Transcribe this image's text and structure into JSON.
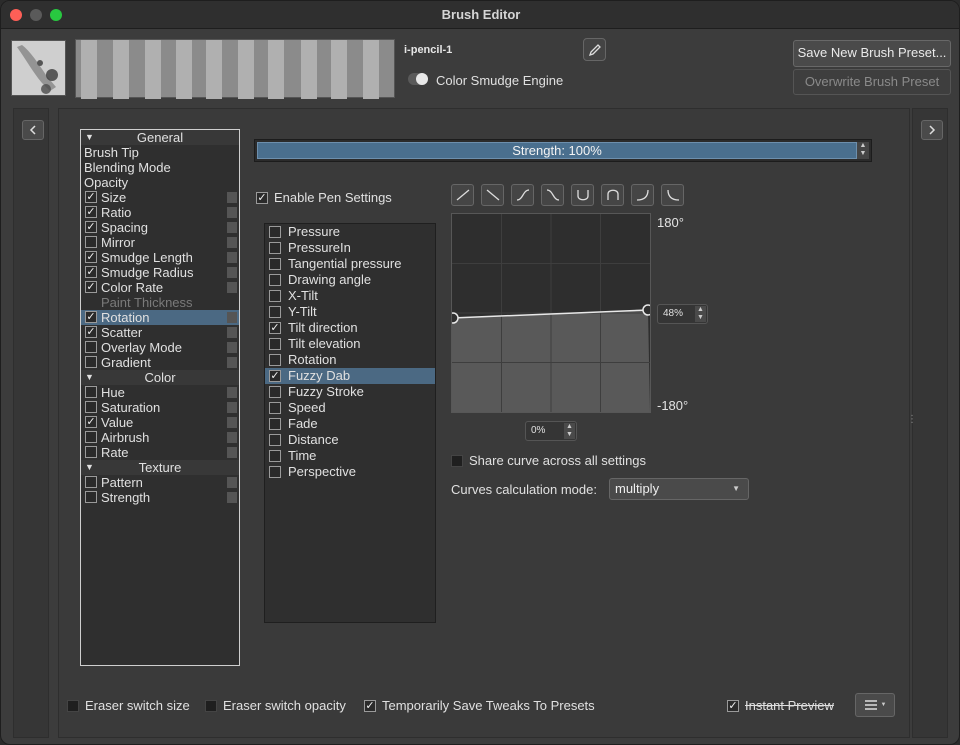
{
  "window": {
    "title": "Brush Editor"
  },
  "header": {
    "preset_name": "i-pencil-1",
    "engine_label": "Color Smudge Engine",
    "save_new_label": "Save New Brush Preset...",
    "overwrite_label": "Overwrite Brush Preset"
  },
  "options": {
    "items": [
      {
        "label": "General",
        "type": "header"
      },
      {
        "label": "Brush Tip",
        "type": "plain"
      },
      {
        "label": "Blending Mode",
        "type": "plain"
      },
      {
        "label": "Opacity",
        "type": "plain"
      },
      {
        "label": "Size",
        "type": "check",
        "checked": true
      },
      {
        "label": "Ratio",
        "type": "check",
        "checked": true
      },
      {
        "label": "Spacing",
        "type": "check",
        "checked": true
      },
      {
        "label": "Mirror",
        "type": "check",
        "checked": false
      },
      {
        "label": "Smudge Length",
        "type": "check",
        "checked": true
      },
      {
        "label": "Smudge Radius",
        "type": "check",
        "checked": true
      },
      {
        "label": "Color Rate",
        "type": "check",
        "checked": true
      },
      {
        "label": "Paint Thickness",
        "type": "disabled"
      },
      {
        "label": "Rotation",
        "type": "check",
        "checked": true,
        "selected": true
      },
      {
        "label": "Scatter",
        "type": "check",
        "checked": true
      },
      {
        "label": "Overlay Mode",
        "type": "check",
        "checked": false
      },
      {
        "label": "Gradient",
        "type": "check",
        "checked": false
      },
      {
        "label": "Color",
        "type": "header"
      },
      {
        "label": "Hue",
        "type": "check",
        "checked": false
      },
      {
        "label": "Saturation",
        "type": "check",
        "checked": false
      },
      {
        "label": "Value",
        "type": "check",
        "checked": true
      },
      {
        "label": "Airbrush",
        "type": "check",
        "checked": false
      },
      {
        "label": "Rate",
        "type": "check",
        "checked": false
      },
      {
        "label": "Texture",
        "type": "header"
      },
      {
        "label": "Pattern",
        "type": "check",
        "checked": false
      },
      {
        "label": "Strength",
        "type": "check",
        "checked": false
      }
    ]
  },
  "strength": {
    "label": "Strength: 100%",
    "value": 1.0
  },
  "enable_pen": {
    "label": "Enable Pen Settings",
    "checked": true
  },
  "sensors": {
    "items": [
      {
        "label": "Pressure",
        "checked": false
      },
      {
        "label": "PressureIn",
        "checked": false
      },
      {
        "label": "Tangential pressure",
        "checked": false
      },
      {
        "label": "Drawing angle",
        "checked": false
      },
      {
        "label": "X-Tilt",
        "checked": false
      },
      {
        "label": "Y-Tilt",
        "checked": false
      },
      {
        "label": "Tilt direction",
        "checked": true
      },
      {
        "label": "Tilt elevation",
        "checked": false
      },
      {
        "label": "Rotation",
        "checked": false
      },
      {
        "label": "Fuzzy Dab",
        "checked": true,
        "selected": true
      },
      {
        "label": "Fuzzy Stroke",
        "checked": false
      },
      {
        "label": "Speed",
        "checked": false
      },
      {
        "label": "Fade",
        "checked": false
      },
      {
        "label": "Distance",
        "checked": false
      },
      {
        "label": "Time",
        "checked": false
      },
      {
        "label": "Perspective",
        "checked": false
      }
    ]
  },
  "curve": {
    "top_label": "180°",
    "bottom_label": "-180°",
    "y_value": "48%",
    "x_value": "0%"
  },
  "share_curve": {
    "label": "Share curve across all settings",
    "checked": false
  },
  "curves_mode": {
    "label": "Curves calculation mode:",
    "value": "multiply"
  },
  "footer": {
    "eraser_size": "Eraser switch size",
    "eraser_opacity": "Eraser switch opacity",
    "save_tweaks": "Temporarily Save Tweaks To Presets",
    "instant_preview": "Instant Preview"
  },
  "colors": {
    "selection": "#4b6983",
    "strength_fill": "#4a6f8e"
  }
}
